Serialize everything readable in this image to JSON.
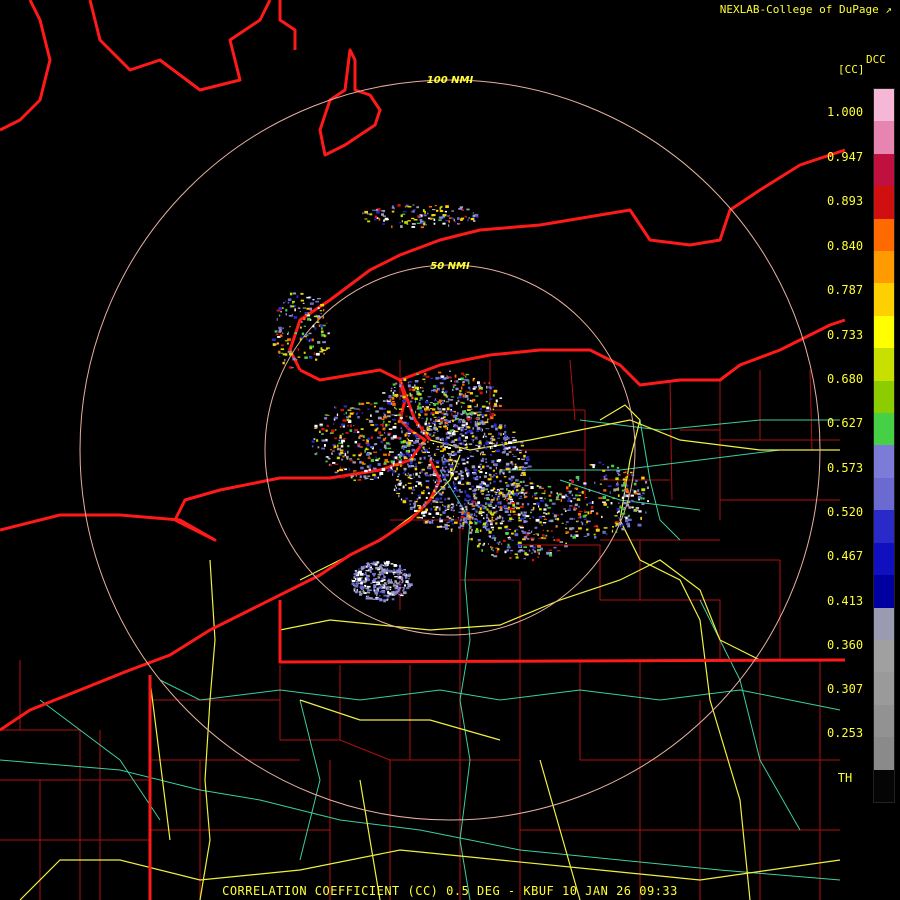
{
  "header": {
    "credit": "NEXLAB-College of DuPage"
  },
  "footer": {
    "title": "CORRELATION COEFFICIENT (CC) 0.5 DEG - KBUF 10 JAN 26 09:33"
  },
  "rings": {
    "outer_label": "100 NMI",
    "inner_label": "50 NMI"
  },
  "legend": {
    "product": "DCC",
    "unit": "[CC]",
    "ticks": [
      "1.000",
      "0.947",
      "0.893",
      "0.840",
      "0.787",
      "0.733",
      "0.680",
      "0.627",
      "0.573",
      "0.520",
      "0.467",
      "0.413",
      "0.360",
      "0.307",
      "0.253",
      "TH"
    ],
    "colors": [
      "#f6b6d6",
      "#e884b0",
      "#c01040",
      "#d01010",
      "#ff6a00",
      "#ff9a00",
      "#ffd000",
      "#ffff00",
      "#c8e000",
      "#8ccc00",
      "#46d046",
      "#7c7cd8",
      "#6a6ad0",
      "#2a2ac8",
      "#1010c0",
      "#0000a0",
      "#9a9ab0",
      "#a0a0a0",
      "#9a9a9a",
      "#929292",
      "#8a8a8a",
      "#050505"
    ]
  },
  "colors": {
    "background": "#000000",
    "state_border": "#ff1a1a",
    "county_border": "#b01010",
    "interstate": "#f0f040",
    "highway": "#3ccfa0",
    "range_ring": "#e8b0a0",
    "text": "#ffff33"
  }
}
